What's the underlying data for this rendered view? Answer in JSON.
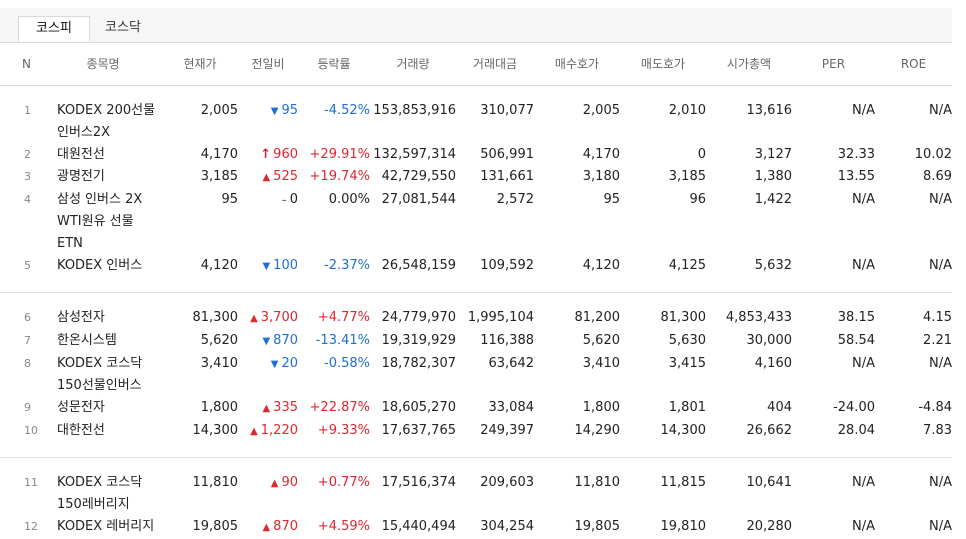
{
  "tabs": [
    {
      "label": "코스피",
      "active": true
    },
    {
      "label": "코스닥",
      "active": false
    }
  ],
  "columns": [
    "N",
    "종목명",
    "현재가",
    "전일비",
    "등락률",
    "거래량",
    "거래대금",
    "매수호가",
    "매도호가",
    "시가총액",
    "PER",
    "ROE"
  ],
  "rows": [
    {
      "n": "1",
      "name": "KODEX 200선물인버스2X",
      "price": "2,005",
      "dir": "down",
      "change": "95",
      "rate": "-4.52%",
      "volume": "153,853,916",
      "amount": "310,077",
      "bid": "2,005",
      "ask": "2,010",
      "cap": "13,616",
      "per": "N/A",
      "roe": "N/A",
      "tall": true
    },
    {
      "n": "2",
      "name": "대원전선",
      "price": "4,170",
      "dir": "limit-up",
      "change": "960",
      "rate": "+29.91%",
      "volume": "132,597,314",
      "amount": "506,991",
      "bid": "4,170",
      "ask": "0",
      "cap": "3,127",
      "per": "32.33",
      "roe": "10.02"
    },
    {
      "n": "3",
      "name": "광명전기",
      "price": "3,185",
      "dir": "up",
      "change": "525",
      "rate": "+19.74%",
      "volume": "42,729,550",
      "amount": "131,661",
      "bid": "3,180",
      "ask": "3,185",
      "cap": "1,380",
      "per": "13.55",
      "roe": "8.69"
    },
    {
      "n": "4",
      "name": "삼성 인버스 2X WTI원유 선물 ETN",
      "price": "95",
      "dir": "flat",
      "change": "0",
      "rate": "0.00%",
      "volume": "27,081,544",
      "amount": "2,572",
      "bid": "95",
      "ask": "96",
      "cap": "1,422",
      "per": "N/A",
      "roe": "N/A",
      "tall": true
    },
    {
      "n": "5",
      "name": "KODEX 인버스",
      "price": "4,120",
      "dir": "down",
      "change": "100",
      "rate": "-2.37%",
      "volume": "26,548,159",
      "amount": "109,592",
      "bid": "4,120",
      "ask": "4,125",
      "cap": "5,632",
      "per": "N/A",
      "roe": "N/A"
    },
    {
      "n": "6",
      "name": "삼성전자",
      "price": "81,300",
      "dir": "up",
      "change": "3,700",
      "rate": "+4.77%",
      "volume": "24,779,970",
      "amount": "1,995,104",
      "bid": "81,200",
      "ask": "81,300",
      "cap": "4,853,433",
      "per": "38.15",
      "roe": "4.15"
    },
    {
      "n": "7",
      "name": "한온시스템",
      "price": "5,620",
      "dir": "down",
      "change": "870",
      "rate": "-13.41%",
      "volume": "19,319,929",
      "amount": "116,388",
      "bid": "5,620",
      "ask": "5,630",
      "cap": "30,000",
      "per": "58.54",
      "roe": "2.21"
    },
    {
      "n": "8",
      "name": "KODEX 코스닥150선물인버스",
      "price": "3,410",
      "dir": "down",
      "change": "20",
      "rate": "-0.58%",
      "volume": "18,782,307",
      "amount": "63,642",
      "bid": "3,410",
      "ask": "3,415",
      "cap": "4,160",
      "per": "N/A",
      "roe": "N/A",
      "tall": true
    },
    {
      "n": "9",
      "name": "성문전자",
      "price": "1,800",
      "dir": "up",
      "change": "335",
      "rate": "+22.87%",
      "volume": "18,605,270",
      "amount": "33,084",
      "bid": "1,800",
      "ask": "1,801",
      "cap": "404",
      "per": "-24.00",
      "roe": "-4.84"
    },
    {
      "n": "10",
      "name": "대한전선",
      "price": "14,300",
      "dir": "up",
      "change": "1,220",
      "rate": "+9.33%",
      "volume": "17,637,765",
      "amount": "249,397",
      "bid": "14,290",
      "ask": "14,300",
      "cap": "26,662",
      "per": "28.04",
      "roe": "7.83"
    },
    {
      "n": "11",
      "name": "KODEX 코스닥150레버리지",
      "price": "11,810",
      "dir": "up",
      "change": "90",
      "rate": "+0.77%",
      "volume": "17,516,374",
      "amount": "209,603",
      "bid": "11,810",
      "ask": "11,815",
      "cap": "10,641",
      "per": "N/A",
      "roe": "N/A",
      "tall": true
    },
    {
      "n": "12",
      "name": "KODEX 레버리지",
      "price": "19,805",
      "dir": "up",
      "change": "870",
      "rate": "+4.59%",
      "volume": "15,440,494",
      "amount": "304,254",
      "bid": "19,805",
      "ask": "19,810",
      "cap": "20,280",
      "per": "N/A",
      "roe": "N/A"
    }
  ],
  "arrows": {
    "up": "▲",
    "down": "▼",
    "flat": "–",
    "limit-up": "↑"
  }
}
